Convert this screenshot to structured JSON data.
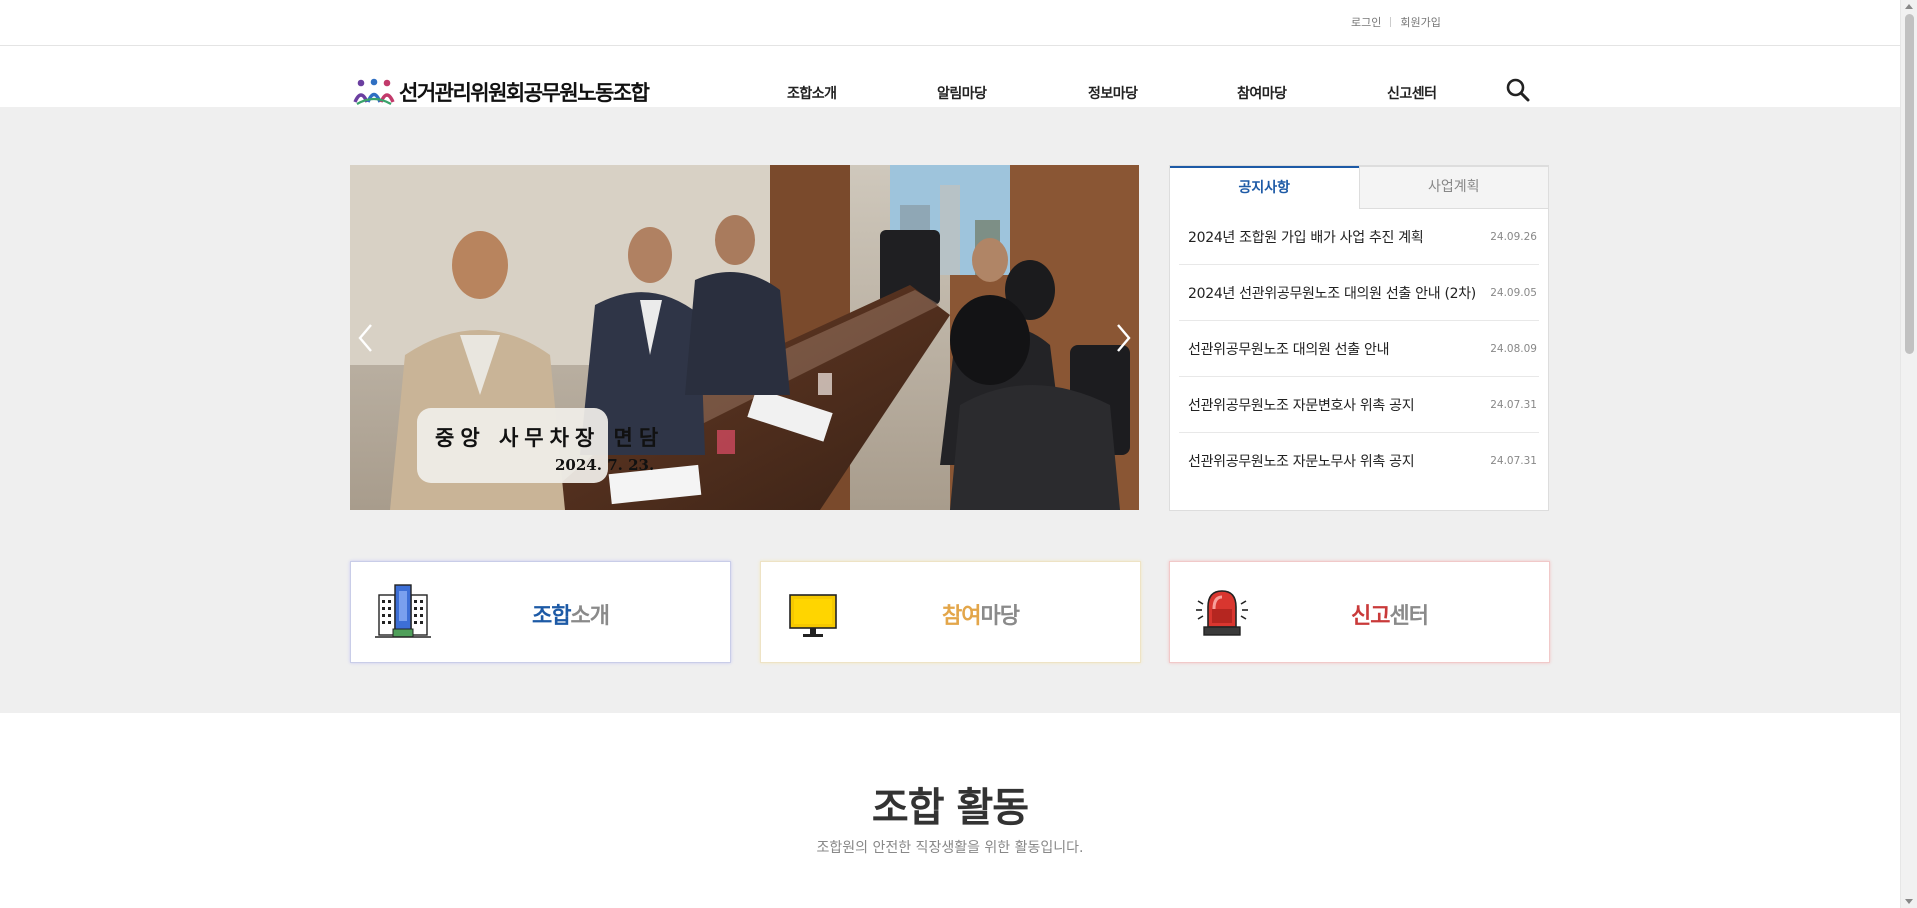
{
  "util_links": {
    "login": "로그인",
    "signup": "회원가입"
  },
  "logo": {
    "text": "선거관리위원회공무원노동조합"
  },
  "nav": [
    "조합소개",
    "알림마당",
    "정보마당",
    "참여마당",
    "신고센터"
  ],
  "slider": {
    "caption_title": "중앙 사무차장 면담",
    "caption_date": "2024. 7. 23."
  },
  "board": {
    "tabs": [
      "공지사항",
      "사업계획"
    ],
    "active_tab": 0,
    "notices": [
      {
        "title": "2024년 조합원 가입 배가 사업 추진 계획",
        "date": "24.09.26"
      },
      {
        "title": "2024년 선관위공무원노조 대의원 선출 안내 (2차)",
        "date": "24.09.05"
      },
      {
        "title": "선관위공무원노조 대의원 선출 안내",
        "date": "24.08.09"
      },
      {
        "title": "선관위공무원노조 자문변호사 위촉 공지",
        "date": "24.07.31"
      },
      {
        "title": "선관위공무원노조 자문노무사 위촉 공지",
        "date": "24.07.31"
      }
    ]
  },
  "quick": [
    {
      "accent": "조합",
      "rest": "소개",
      "color": "#1d5aa6",
      "icon": "building-icon"
    },
    {
      "accent": "참여",
      "rest": "마당",
      "color": "#e3a64a",
      "icon": "monitor-icon"
    },
    {
      "accent": "신고",
      "rest": "센터",
      "color": "#c93a3a",
      "icon": "siren-icon"
    }
  ],
  "section": {
    "title": "조합 활동",
    "desc": "조합원의 안전한 직장생활을 위한 활동입니다."
  },
  "colors": {
    "brand_blue": "#1d5aa6",
    "band_gray": "#efefef"
  }
}
